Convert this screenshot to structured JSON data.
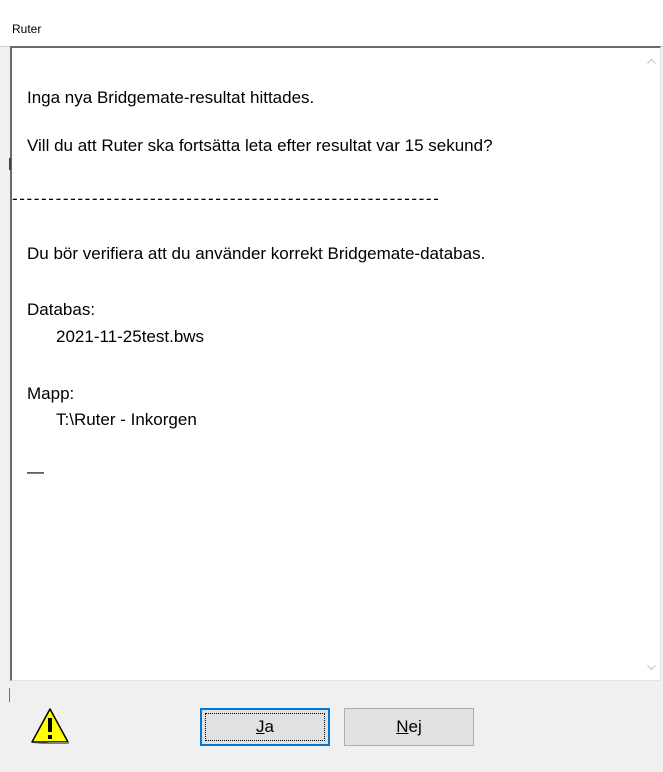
{
  "window": {
    "title": "Ruter"
  },
  "message": {
    "line1": "Inga nya Bridgemate-resultat hittades.",
    "line2": "Vill du att Ruter ska fortsätta leta efter resultat var 15 sekund?",
    "separator": "-----------------------------------------------------------",
    "line3": "Du bör verifiera att du använder korrekt Bridgemate-databas.",
    "database_label": "Databas:",
    "database_value": "2021-11-25test.bws",
    "folder_label": "Mapp:",
    "folder_value": "T:\\Ruter - Inkorgen",
    "trailer": "—"
  },
  "buttons": {
    "yes": {
      "mnemonic": "J",
      "rest": "a"
    },
    "no": {
      "mnemonic": "N",
      "rest": "ej"
    }
  },
  "icons": {
    "warning": "warning-icon",
    "scroll_up": "scroll-up-icon",
    "scroll_down": "scroll-down-icon"
  },
  "colors": {
    "focus_border": "#0078d7",
    "warning_fill": "#ffff00"
  }
}
